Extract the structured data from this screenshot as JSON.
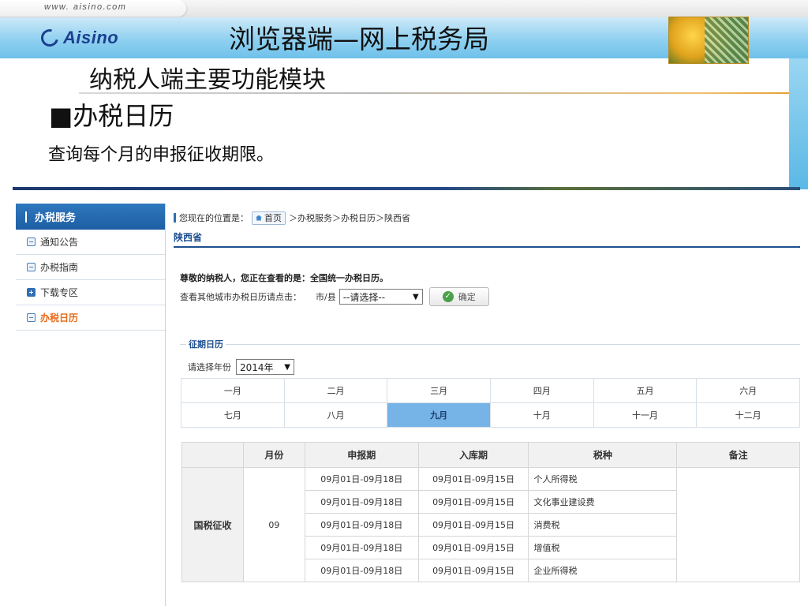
{
  "slide": {
    "site_url": "www. aisino.com",
    "logo_text": "Aisino",
    "title": "浏览器端—网上税务局",
    "subtitle": "纳税人端主要功能模块",
    "heading": "■办税日历",
    "description": "查询每个月的申报征收期限。"
  },
  "sidebar": {
    "header": "办税服务",
    "items": [
      {
        "label": "通知公告",
        "icon": "minus-square-icon"
      },
      {
        "label": "办税指南",
        "icon": "minus-square-icon"
      },
      {
        "label": "下载专区",
        "icon": "plus-square-icon"
      },
      {
        "label": "办税日历",
        "icon": "minus-square-icon",
        "active": true
      }
    ]
  },
  "breadcrumb": {
    "prefix": "您现在的位置是：",
    "home": "首页",
    "sep1": "＞",
    "item1": "办税服务",
    "sep2": "＞",
    "item2": "办税日历",
    "sep3": "＞",
    "item3": "陕西省"
  },
  "province": "陕西省",
  "notice": "尊敬的纳税人，您正在查看的是：全国统一办税日历。",
  "city": {
    "prompt": "查看其他城市办税日历请点击：",
    "label": "市/县",
    "selected": "--请选择--",
    "button": "确定"
  },
  "calendar": {
    "legend": "征期日历",
    "year_label": "请选择年份",
    "year_selected": "2014年",
    "months_row1": [
      "一月",
      "二月",
      "三月",
      "四月",
      "五月",
      "六月"
    ],
    "months_row2": [
      "七月",
      "八月",
      "九月",
      "十月",
      "十一月",
      "十二月"
    ],
    "selected_month": "九月"
  },
  "table": {
    "headers": [
      "",
      "月份",
      "申报期",
      "入库期",
      "税种",
      "备注"
    ],
    "category": "国税征收",
    "month": "09",
    "rows": [
      {
        "declare": "09月01日-09月18日",
        "storage": "09月01日-09月15日",
        "tax": "个人所得税"
      },
      {
        "declare": "09月01日-09月18日",
        "storage": "09月01日-09月15日",
        "tax": "文化事业建设费"
      },
      {
        "declare": "09月01日-09月18日",
        "storage": "09月01日-09月15日",
        "tax": "消费税"
      },
      {
        "declare": "09月01日-09月18日",
        "storage": "09月01日-09月15日",
        "tax": "增值税"
      },
      {
        "declare": "09月01日-09月18日",
        "storage": "09月01日-09月15日",
        "tax": "企业所得税"
      }
    ]
  },
  "colors": {
    "accent_blue": "#1d4f8f",
    "sidebar_header": "#2f78be",
    "active_item": "#e56a1a",
    "selected_month": "#76b3e6"
  }
}
